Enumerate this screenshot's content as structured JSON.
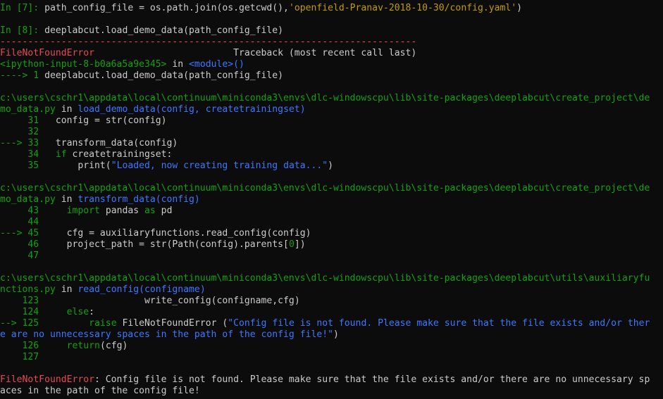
{
  "terminal": {
    "lines": [
      [
        [
          "g",
          "In [7]: "
        ],
        [
          "w",
          "path_config_file = os.path.join(os.getcwd(),"
        ],
        [
          "y",
          "'openfield-Pranav-2018-10-30/config.yaml'"
        ],
        [
          "w",
          ")"
        ]
      ],
      [],
      [
        [
          "g",
          "In [8]: "
        ],
        [
          "w",
          "deeplabcut.load_demo_data(path_config_file)"
        ]
      ],
      [
        [
          "r",
          "---------------------------------------------------------------------------"
        ]
      ],
      [
        [
          "r",
          "FileNotFoundError"
        ],
        [
          "w",
          "                         Traceback (most recent call last)"
        ]
      ],
      [
        [
          "g",
          "<ipython-input-8-b0a6a5a9e345>"
        ],
        [
          "w",
          " in "
        ],
        [
          "b",
          "<module>()"
        ]
      ],
      [
        [
          "g",
          "----> 1 "
        ],
        [
          "w",
          "deeplabcut.load_demo_data(path_config_file)"
        ]
      ],
      [],
      [
        [
          "g",
          "c:\\users\\cschr1\\appdata\\local\\continuum\\miniconda3\\envs\\dlc-windowscpu\\lib\\site-packages\\deeplabcut\\create_project\\de"
        ]
      ],
      [
        [
          "g",
          "mo_data.py"
        ],
        [
          "w",
          " in "
        ],
        [
          "b",
          "load_demo_data(config, createtrainingset)"
        ]
      ],
      [
        [
          "g",
          "     31 "
        ],
        [
          "w",
          "  config = str(config)"
        ]
      ],
      [
        [
          "g",
          "     32 "
        ]
      ],
      [
        [
          "g",
          "---> 33 "
        ],
        [
          "w",
          "  transform_data(config)"
        ]
      ],
      [
        [
          "g",
          "     34 "
        ],
        [
          "w",
          "  "
        ],
        [
          "g",
          "if"
        ],
        [
          "w",
          " createtrainingset:"
        ]
      ],
      [
        [
          "g",
          "     35 "
        ],
        [
          "w",
          "      print("
        ],
        [
          "b",
          "\"Loaded, now creating training data...\""
        ],
        [
          "w",
          ")"
        ]
      ],
      [],
      [
        [
          "g",
          "c:\\users\\cschr1\\appdata\\local\\continuum\\miniconda3\\envs\\dlc-windowscpu\\lib\\site-packages\\deeplabcut\\create_project\\de"
        ]
      ],
      [
        [
          "g",
          "mo_data.py"
        ],
        [
          "w",
          " in "
        ],
        [
          "b",
          "transform_data(config)"
        ]
      ],
      [
        [
          "g",
          "     43 "
        ],
        [
          "w",
          "    "
        ],
        [
          "g",
          "import"
        ],
        [
          "w",
          " pandas "
        ],
        [
          "g",
          "as"
        ],
        [
          "w",
          " pd"
        ]
      ],
      [
        [
          "g",
          "     44 "
        ]
      ],
      [
        [
          "g",
          "---> 45 "
        ],
        [
          "w",
          "    cfg = auxiliaryfunctions.read_config(config)"
        ]
      ],
      [
        [
          "g",
          "     46 "
        ],
        [
          "w",
          "    project_path = str(Path(config).parents["
        ],
        [
          "g",
          "0"
        ],
        [
          "w",
          "])"
        ]
      ],
      [
        [
          "g",
          "     47 "
        ]
      ],
      [],
      [
        [
          "g",
          "c:\\users\\cschr1\\appdata\\local\\continuum\\miniconda3\\envs\\dlc-windowscpu\\lib\\site-packages\\deeplabcut\\utils\\auxiliaryfu"
        ]
      ],
      [
        [
          "g",
          "nctions.py"
        ],
        [
          "w",
          " in "
        ],
        [
          "b",
          "read_config(configname)"
        ]
      ],
      [
        [
          "g",
          "    123 "
        ],
        [
          "w",
          "                  write_config(configname,cfg)"
        ]
      ],
      [
        [
          "g",
          "    124 "
        ],
        [
          "w",
          "    "
        ],
        [
          "g",
          "else"
        ],
        [
          "w",
          ":"
        ]
      ],
      [
        [
          "g",
          "--> 125 "
        ],
        [
          "w",
          "        "
        ],
        [
          "g",
          "raise"
        ],
        [
          "w",
          " FileNotFoundError ("
        ],
        [
          "b",
          "\"Config file is not found. Please make sure that the file exists and/or ther"
        ]
      ],
      [
        [
          "b",
          "e are no unnecessary spaces in the path of the config file!\""
        ],
        [
          "w",
          ")"
        ]
      ],
      [
        [
          "g",
          "    126 "
        ],
        [
          "w",
          "    "
        ],
        [
          "g",
          "return"
        ],
        [
          "w",
          "(cfg)"
        ]
      ],
      [
        [
          "g",
          "    127 "
        ]
      ],
      [],
      [
        [
          "r",
          "FileNotFoundError"
        ],
        [
          "w",
          ": Config file is not found. Please make sure that the file exists and/or there are no unnecessary sp"
        ]
      ],
      [
        [
          "w",
          "aces in the path of the config file!"
        ]
      ]
    ]
  },
  "colors": {
    "background": "#0c0c0c",
    "text": "#cccccc",
    "green": "#13a10e",
    "red": "#e74856",
    "blue": "#3b78ff",
    "yellow": "#c19c00"
  }
}
